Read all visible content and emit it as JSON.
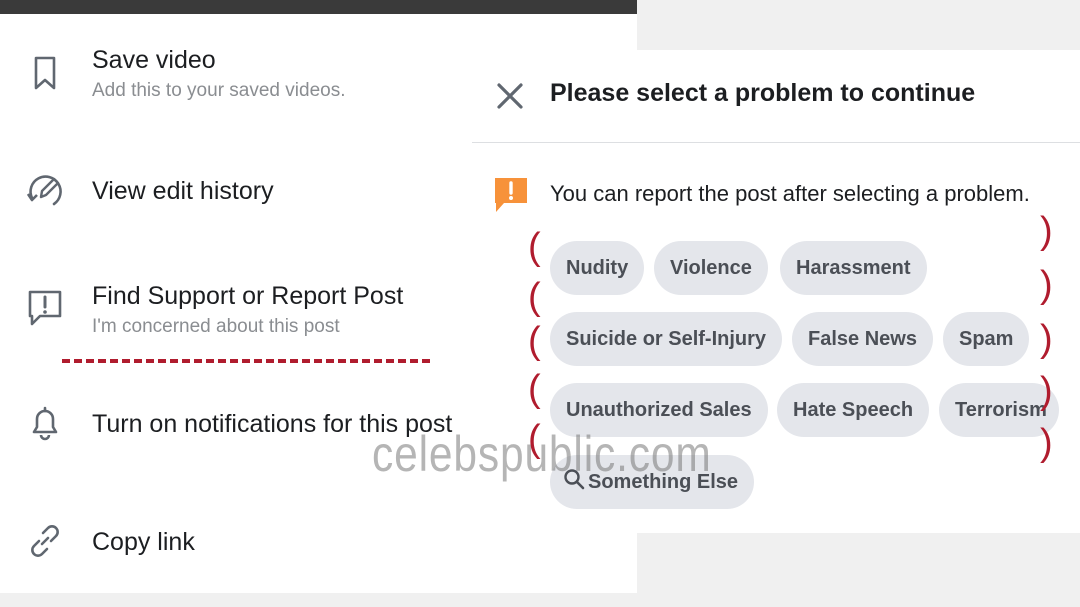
{
  "menu": {
    "items": [
      {
        "title": "Save video",
        "subtitle": "Add this to your saved videos.",
        "icon": "bookmark-icon"
      },
      {
        "title": "View edit history",
        "icon": "edit-history-icon"
      },
      {
        "title": "Find Support or Report Post",
        "subtitle": "I'm concerned about this post",
        "icon": "report-icon"
      },
      {
        "title": "Turn on notifications for this post",
        "icon": "bell-icon"
      },
      {
        "title": "Copy link",
        "icon": "link-icon"
      }
    ]
  },
  "dialog": {
    "title": "Please select a problem to continue",
    "info": "You can report the post after selecting a problem.",
    "problems": [
      "Nudity",
      "Violence",
      "Harassment",
      "Suicide or Self-Injury",
      "False News",
      "Spam",
      "Unauthorized Sales",
      "Hate Speech",
      "Terrorism",
      "Something Else"
    ],
    "accent_color": "#f7923a"
  },
  "watermark": "celebspublic.com",
  "colors": {
    "annotation": "#b01c2e",
    "chip_bg": "#e4e6eb"
  }
}
